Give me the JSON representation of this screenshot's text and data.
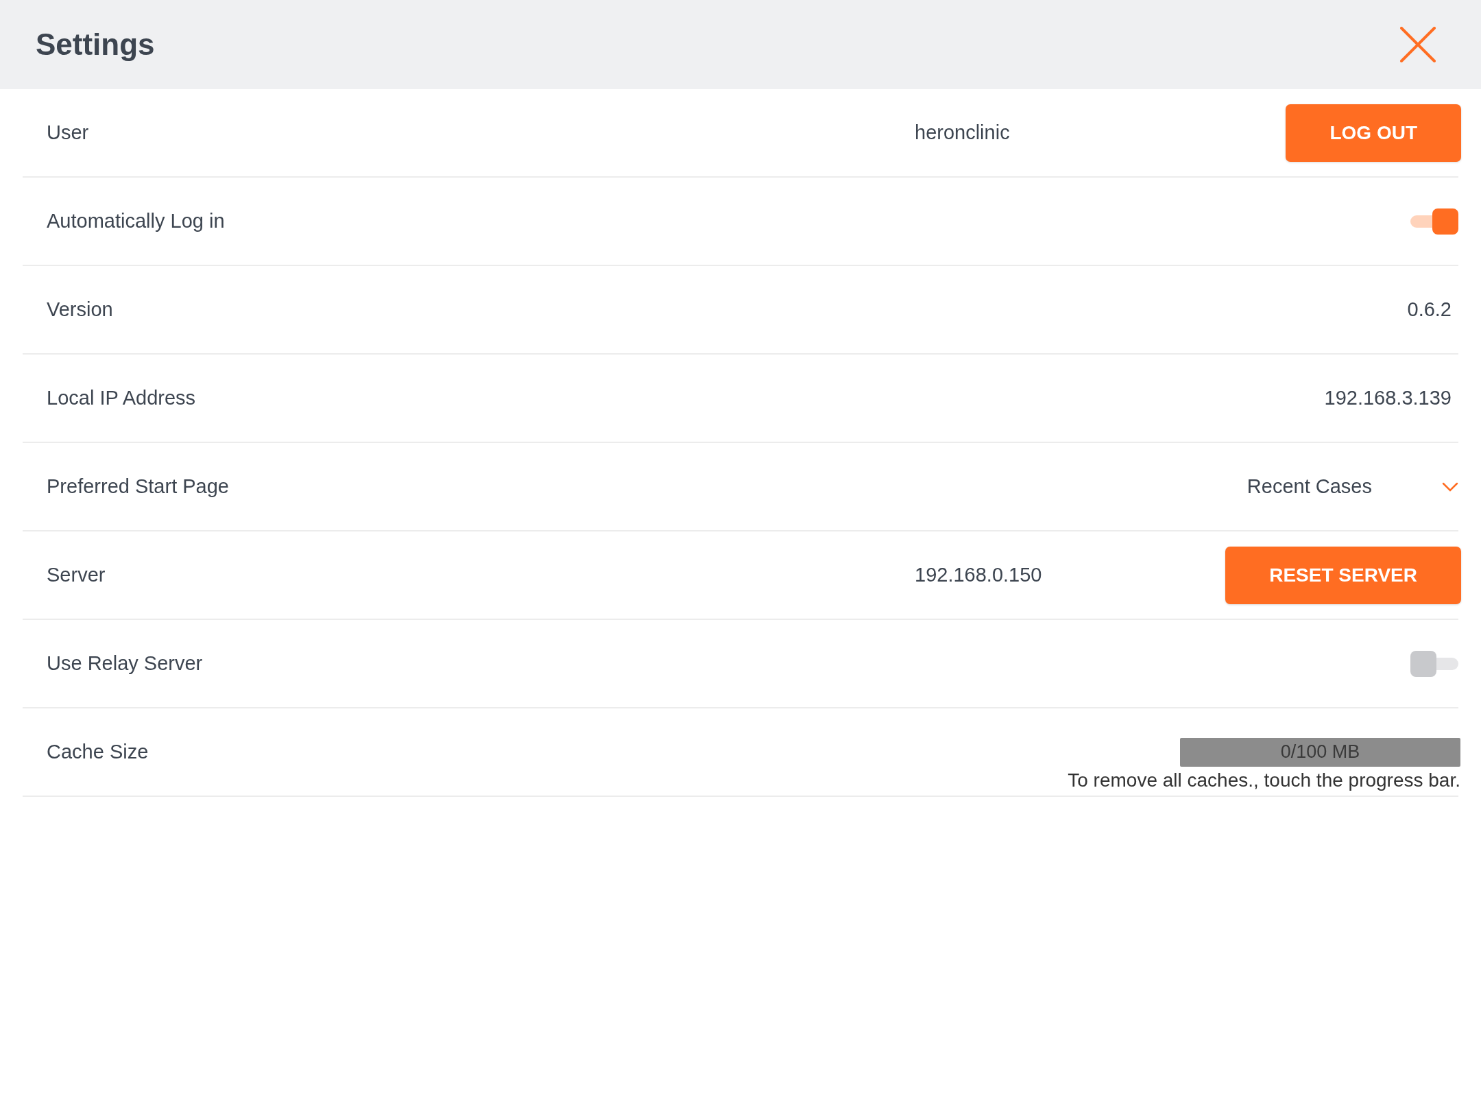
{
  "header": {
    "title": "Settings"
  },
  "rows": [
    {
      "kind": "value_button",
      "label": "User",
      "value": "heronclinic",
      "button": "LOG OUT"
    },
    {
      "kind": "toggle",
      "label": "Automatically Log in",
      "on": true
    },
    {
      "kind": "text",
      "label": "Version",
      "value": "0.6.2"
    },
    {
      "kind": "text",
      "label": "Local IP Address",
      "value": "192.168.3.139"
    },
    {
      "kind": "dropdown",
      "label": "Preferred Start Page",
      "value": "Recent Cases"
    },
    {
      "kind": "value_button",
      "label": "Server",
      "value": "192.168.0.150",
      "button": "RESET SERVER"
    },
    {
      "kind": "toggle",
      "label": "Use Relay Server",
      "on": false
    },
    {
      "kind": "progress",
      "label": "Cache Size",
      "level": 0,
      "reading": "0/100 MB",
      "hint": "To remove all caches., touch the progress bar."
    }
  ]
}
